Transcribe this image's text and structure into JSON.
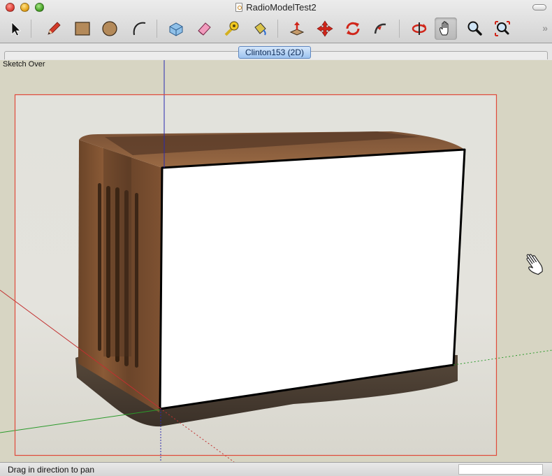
{
  "window": {
    "title": "RadioModelTest2"
  },
  "toolbar": {
    "tools": [
      {
        "name": "select",
        "icon": "select-arrow-icon",
        "active": false
      },
      {
        "name": "pencil",
        "icon": "pencil-icon",
        "active": false
      },
      {
        "name": "rectangle",
        "icon": "rectangle-icon",
        "active": false
      },
      {
        "name": "circle",
        "icon": "circle-icon",
        "active": false
      },
      {
        "name": "arc",
        "icon": "arc-icon",
        "active": false
      },
      {
        "name": "make-component",
        "icon": "make-component-icon",
        "active": false
      },
      {
        "name": "eraser",
        "icon": "eraser-icon",
        "active": false
      },
      {
        "name": "tape-measure",
        "icon": "tape-measure-icon",
        "active": false
      },
      {
        "name": "paint-bucket",
        "icon": "paint-bucket-icon",
        "active": false
      },
      {
        "name": "push-pull",
        "icon": "push-pull-icon",
        "active": false
      },
      {
        "name": "move",
        "icon": "move-icon",
        "active": false
      },
      {
        "name": "rotate",
        "icon": "rotate-icon",
        "active": false
      },
      {
        "name": "follow-me",
        "icon": "follow-me-icon",
        "active": false
      },
      {
        "name": "orbit",
        "icon": "orbit-icon",
        "active": false
      },
      {
        "name": "pan",
        "icon": "pan-hand-icon",
        "active": true
      },
      {
        "name": "zoom",
        "icon": "zoom-icon",
        "active": false
      },
      {
        "name": "zoom-extents",
        "icon": "zoom-extents-icon",
        "active": false
      }
    ],
    "overflow_label": "»"
  },
  "scenes": {
    "active_tab": "Clinton153 (2D)"
  },
  "viewport": {
    "style_label": "Sketch Over",
    "colors": {
      "background": "#d7d5c3",
      "photo_frame": "#e04a3a",
      "face": "#ffffff",
      "axis_red": "#c23030",
      "axis_green": "#2a9a2a",
      "axis_blue": "#2a2ab0"
    }
  },
  "statusbar": {
    "message": "Drag in direction to pan",
    "measurements_value": ""
  }
}
